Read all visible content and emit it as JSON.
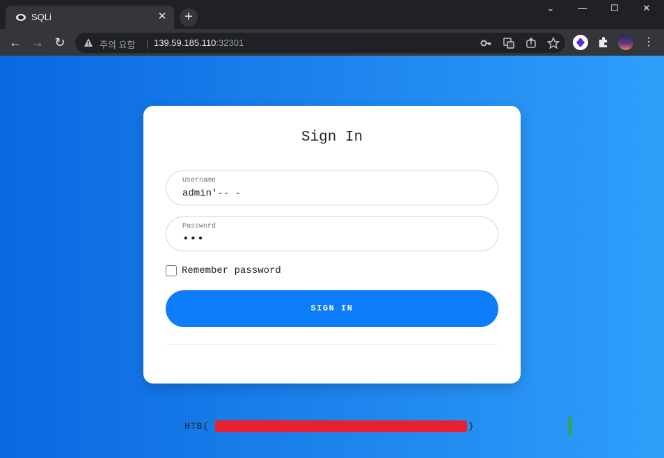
{
  "browser": {
    "tab": {
      "title": "SQLi"
    },
    "new_tab_symbol": "+",
    "window_controls": {
      "minimize": "—",
      "maximize": "☐",
      "close": "✕",
      "tab_search": "⌄"
    },
    "nav": {
      "back": "←",
      "forward": "→",
      "reload": "↻"
    },
    "omnibox": {
      "warning": "주의 요함",
      "separator": "|",
      "host": "139.59.185.110",
      "port": ":32301"
    },
    "icons": [
      "key-icon",
      "translate-icon",
      "share-icon",
      "star-icon",
      "extension-icon",
      "puzzle-icon",
      "avatar",
      "menu-icon"
    ]
  },
  "login": {
    "title": "Sign In",
    "username": {
      "label": "Username",
      "value": "admin'-- -"
    },
    "password": {
      "label": "Password",
      "value": "•••"
    },
    "remember_label": "Remember password",
    "button_label": "SIGN IN"
  },
  "flag": {
    "prefix": "HTB{",
    "suffix": "}"
  },
  "colors": {
    "button": "#0d7cf8",
    "gradient_start": "#0a68e0",
    "gradient_end": "#2f9efa",
    "redaction": "#e8202f",
    "cursor": "#2fa65a"
  }
}
